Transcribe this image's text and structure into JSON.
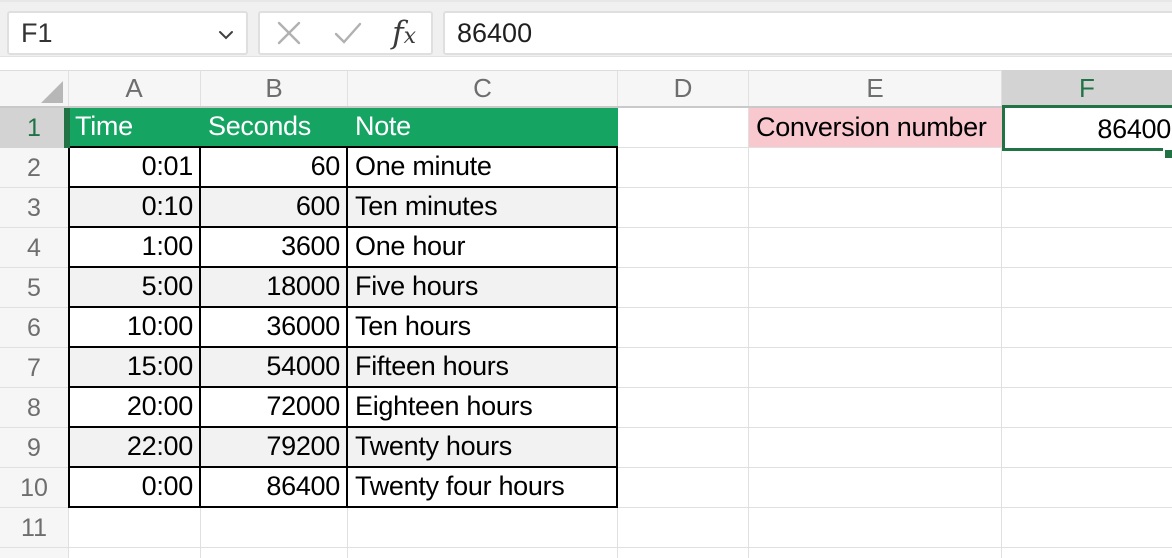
{
  "formula_bar": {
    "name_box_value": "F1",
    "formula_value": "86400",
    "fx_f": "f",
    "fx_x": "x"
  },
  "colors": {
    "table_header_fill": "#16A463",
    "selection_green": "#217346",
    "conversion_fill": "#F9C8CE",
    "banded_row_fill": "#F2F2F2"
  },
  "sheet": {
    "selected_cell": "F1",
    "column_headers": [
      "A",
      "B",
      "C",
      "D",
      "E",
      "F"
    ],
    "row_headers": [
      "1",
      "2",
      "3",
      "4",
      "5",
      "6",
      "7",
      "8",
      "9",
      "10",
      "11"
    ],
    "table": {
      "headers": [
        "Time",
        "Seconds",
        "Note"
      ],
      "rows": [
        [
          "0:01",
          "60",
          "One minute"
        ],
        [
          "0:10",
          "600",
          "Ten minutes"
        ],
        [
          "1:00",
          "3600",
          "One hour"
        ],
        [
          "5:00",
          "18000",
          "Five hours"
        ],
        [
          "10:00",
          "36000",
          "Ten hours"
        ],
        [
          "15:00",
          "54000",
          "Fifteen hours"
        ],
        [
          "20:00",
          "72000",
          "Eighteen hours"
        ],
        [
          "22:00",
          "79200",
          "Twenty hours"
        ],
        [
          "0:00",
          "86400",
          "Twenty four hours"
        ]
      ]
    },
    "conversion": {
      "label": "Conversion number",
      "value": "86400"
    }
  }
}
